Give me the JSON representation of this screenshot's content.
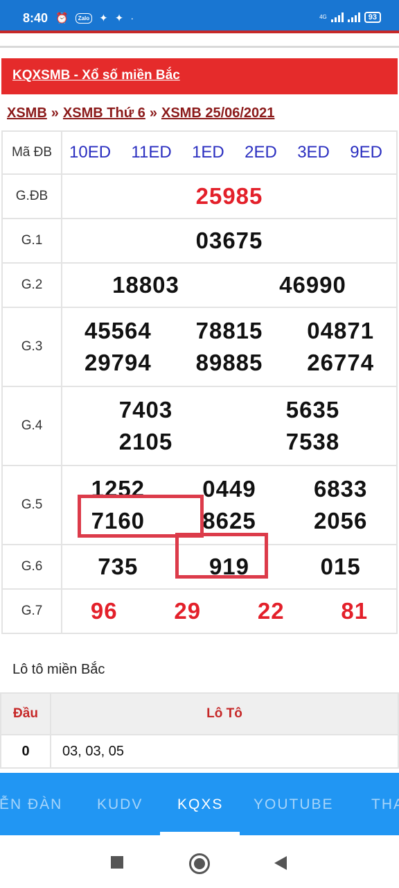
{
  "status": {
    "time": "8:40",
    "zalo": "Zalo",
    "network": "4G",
    "battery": "93"
  },
  "header": {
    "title": "KQXSMB - Xổ số miền Bắc"
  },
  "breadcrumb": {
    "a": "XSMB",
    "b": "XSMB Thứ 6",
    "c": "XSMB 25/06/2021",
    "sep": "»"
  },
  "results": {
    "ma_label": "Mã ĐB",
    "ma_codes": [
      "10ED",
      "11ED",
      "1ED",
      "2ED",
      "3ED",
      "9ED"
    ],
    "labels": [
      "G.ĐB",
      "G.1",
      "G.2",
      "G.3",
      "G.4",
      "G.5",
      "G.6",
      "G.7"
    ],
    "gdb": "25985",
    "g1": "03675",
    "g2": [
      "18803",
      "46990"
    ],
    "g3": [
      "45564",
      "78815",
      "04871",
      "29794",
      "89885",
      "26774"
    ],
    "g4": [
      "7403",
      "5635",
      "2105",
      "7538"
    ],
    "g5": [
      "1252",
      "0449",
      "6833",
      "7160",
      "8625",
      "2056"
    ],
    "g6": [
      "735",
      "919",
      "015"
    ],
    "g7": [
      "96",
      "29",
      "22",
      "81"
    ]
  },
  "loto": {
    "title": "Lô tô miền Bắc",
    "col_dau": "Đầu",
    "col_loto": "Lô Tô",
    "rows": [
      {
        "dau": "0",
        "values": "03, 03, 05"
      }
    ]
  },
  "nav": {
    "tabs": [
      "DIỄN ĐÀN",
      "KUDV",
      "KQXS",
      "YOUTUBE",
      "THA"
    ]
  },
  "colors": {
    "statusbar": "#1976d2",
    "header_red": "#e52b2b",
    "number_red": "#e3202a",
    "code_blue": "#2a2ec0",
    "navbar": "#2196f3"
  }
}
